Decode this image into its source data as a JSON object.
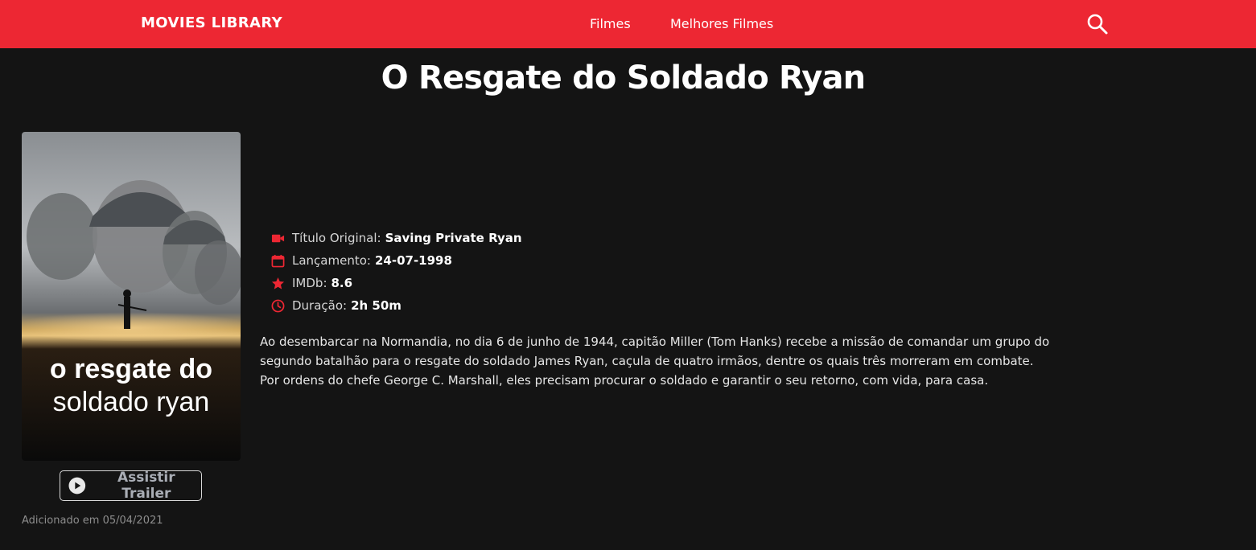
{
  "navbar": {
    "brand": "MOVIES LIBRARY",
    "links": [
      "Filmes",
      "Melhores Filmes"
    ],
    "search_icon": "search-icon",
    "color": "#ed2733"
  },
  "movie": {
    "title": "O Resgate do Soldado Ryan",
    "poster_text": [
      "o resgate do",
      "soldado ryan"
    ],
    "info": {
      "original_title_label": "Título Original:",
      "original_title": "Saving Private Ryan",
      "release_label": "Lançamento:",
      "release": "24-07-1998",
      "imdb_label": "IMDb:",
      "imdb": "8.6",
      "duration_label": "Duração:",
      "duration": "2h 50m"
    },
    "synopsis": "Ao desembarcar na Normandia, no dia 6 de junho de 1944, capitão Miller (Tom Hanks) recebe a missão de comandar um grupo do segundo batalhão para o resgate do soldado James Ryan, caçula de quatro irmãos, dentre os quais três morreram em combate. Por ordens do chefe George C. Marshall, eles precisam procurar o soldado e garantir o seu retorno, com vida, para casa.",
    "trailer_label": "Assistir Trailer",
    "added": "Adicionado em 05/04/2021"
  },
  "colors": {
    "accent": "#ed2733",
    "background": "#141414"
  }
}
